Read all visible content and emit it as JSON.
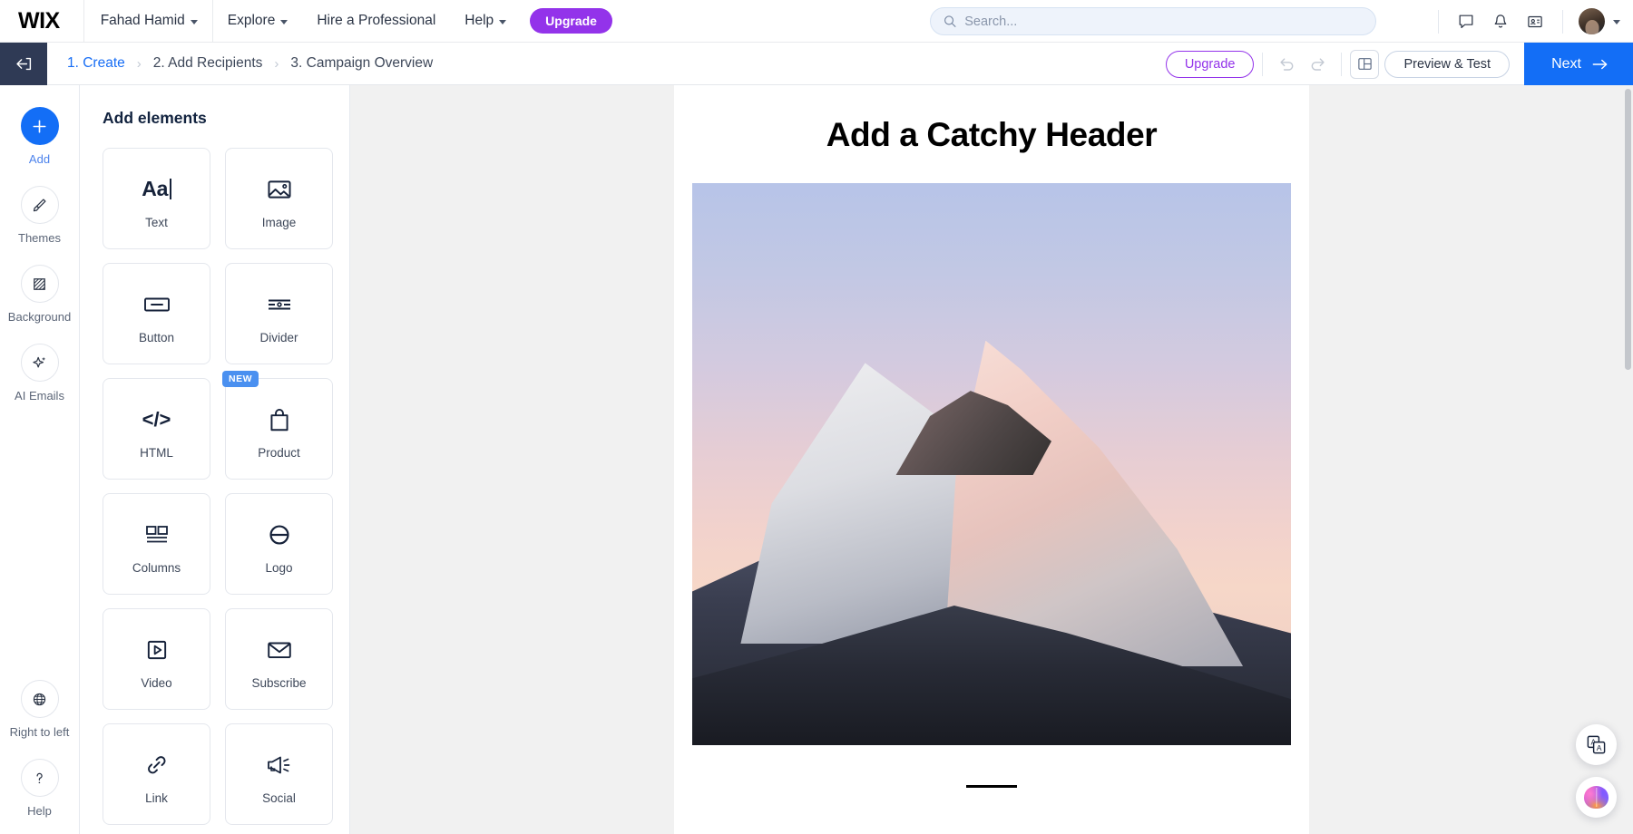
{
  "topbar": {
    "logo": "WIX",
    "nav": [
      {
        "label": "Fahad Hamid",
        "icon": "chevron-down-icon",
        "has_caret": true
      },
      {
        "label": "Explore",
        "icon": "chevron-down-icon",
        "has_caret": true
      },
      {
        "label": "Hire a Professional",
        "has_caret": false
      },
      {
        "label": "Help",
        "icon": "chevron-down-icon",
        "has_caret": true
      }
    ],
    "upgrade_label": "Upgrade",
    "upgrade_color": "#9333ea",
    "search": {
      "placeholder": "Search...",
      "value": "",
      "icon": "search-icon"
    },
    "actions": [
      {
        "name": "chat-icon",
        "label": "Chat"
      },
      {
        "name": "bell-icon",
        "label": "Notifications"
      },
      {
        "name": "contacts-icon",
        "label": "Contacts"
      }
    ],
    "avatar_alt": "User avatar"
  },
  "crumbbar": {
    "back_icon": "back-arrow-icon",
    "crumbs": [
      {
        "label": "1. Create",
        "active": true
      },
      {
        "label": "2. Add Recipients",
        "active": false
      },
      {
        "label": "3. Campaign Overview",
        "active": false
      }
    ],
    "separator": "›",
    "upgrade_label": "Upgrade",
    "undo_icon": "undo-icon",
    "redo_icon": "redo-icon",
    "layout_icon": "layout-panel-icon",
    "preview_label": "Preview & Test",
    "next_label": "Next",
    "next_color": "#136ef6"
  },
  "rail": {
    "items": [
      {
        "label": "Add",
        "icon": "plus-icon",
        "primary": true
      },
      {
        "label": "Themes",
        "icon": "paintbrush-icon",
        "primary": false
      },
      {
        "label": "Background",
        "icon": "background-pattern-icon",
        "primary": false
      },
      {
        "label": "AI Emails",
        "icon": "sparkle-icon",
        "primary": false
      }
    ],
    "bottom_items": [
      {
        "label": "Right to left",
        "icon": "globe-icon"
      },
      {
        "label": "Help",
        "icon": "question-mark-icon"
      }
    ]
  },
  "panel": {
    "title": "Add elements",
    "cards": [
      {
        "label": "Text",
        "icon": "text-aa-icon",
        "badge": null
      },
      {
        "label": "Image",
        "icon": "image-icon",
        "badge": null
      },
      {
        "label": "Button",
        "icon": "button-icon",
        "badge": null
      },
      {
        "label": "Divider",
        "icon": "divider-icon",
        "badge": null
      },
      {
        "label": "HTML",
        "icon": "code-icon",
        "badge": null
      },
      {
        "label": "Product",
        "icon": "shopping-bag-icon",
        "badge": "NEW"
      },
      {
        "label": "Columns",
        "icon": "columns-icon",
        "badge": null
      },
      {
        "label": "Logo",
        "icon": "logo-circle-icon",
        "badge": null
      },
      {
        "label": "Video",
        "icon": "video-play-icon",
        "badge": null
      },
      {
        "label": "Subscribe",
        "icon": "envelope-icon",
        "badge": null
      },
      {
        "label": "Link",
        "icon": "link-chain-icon",
        "badge": null
      },
      {
        "label": "Social",
        "icon": "megaphone-icon",
        "badge": null
      }
    ],
    "badge_color": "#4a90f0"
  },
  "canvas": {
    "email_header": "Add a Catchy Header",
    "image_alt": "Snow-capped mountain peak at sunset",
    "divider_present": true
  },
  "floating": {
    "buttons": [
      {
        "name": "translate-icon",
        "label": "Translate"
      },
      {
        "name": "ai-brain-icon",
        "label": "AI Assistant"
      }
    ]
  }
}
